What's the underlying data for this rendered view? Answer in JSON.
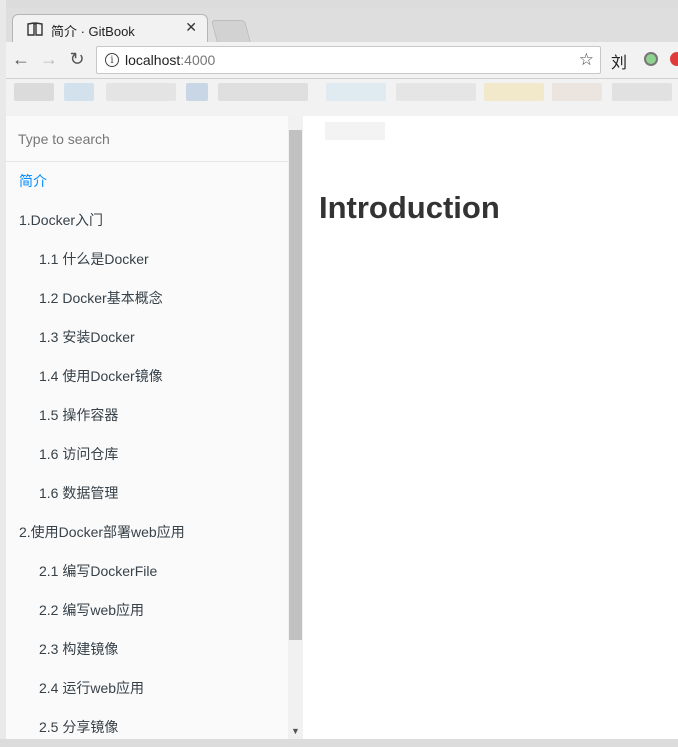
{
  "browser": {
    "tab_title": "简介 · GitBook",
    "url_host": "localhost",
    "url_port": ":4000",
    "ext1_label": "刘"
  },
  "sidebar": {
    "search_placeholder": "Type to search",
    "items": [
      {
        "label": "简介",
        "active": true,
        "level": 1
      },
      {
        "label": "1.Docker入门",
        "level": 1
      },
      {
        "label": "1.1 什么是Docker",
        "level": 2
      },
      {
        "label": "1.2 Docker基本概念",
        "level": 2
      },
      {
        "label": "1.3 安装Docker",
        "level": 2
      },
      {
        "label": "1.4 使用Docker镜像",
        "level": 2
      },
      {
        "label": "1.5 操作容器",
        "level": 2
      },
      {
        "label": "1.6 访问仓库",
        "level": 2
      },
      {
        "label": "1.6 数据管理",
        "level": 2
      },
      {
        "label": "2.使用Docker部署web应用",
        "level": 1
      },
      {
        "label": "2.1 编写DockerFile",
        "level": 2
      },
      {
        "label": "2.2 编写web应用",
        "level": 2
      },
      {
        "label": "2.3 构建镜像",
        "level": 2
      },
      {
        "label": "2.4 运行web应用",
        "level": 2
      },
      {
        "label": "2.5 分享镜像",
        "level": 2
      }
    ]
  },
  "content": {
    "heading": "Introduction"
  },
  "colors": {
    "active_link": "#008cff",
    "nav_text": "#364149"
  }
}
